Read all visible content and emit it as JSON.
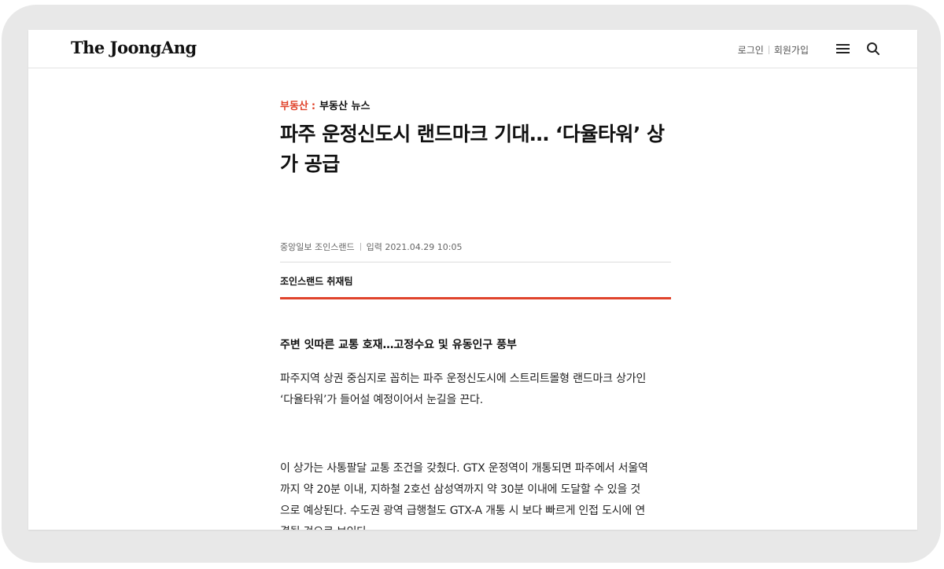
{
  "header": {
    "logo": "The JoongAng",
    "login": "로그인",
    "signup": "회원가입",
    "menu_icon": "hamburger-menu-icon",
    "search_icon": "search-icon"
  },
  "article": {
    "section": "부동산",
    "section_separator": ":",
    "subsection": "부동산 뉴스",
    "headline": "파주 운정신도시 랜드마크 기대… ‘다율타워’ 상가 공급",
    "source": "중앙일보 조인스랜드",
    "published": "입력 2021.04.29 10:05",
    "byline": "조인스랜드 취재팀",
    "subheadline": "주변 잇따른 교통 호재…고정수요 및 유동인구 풍부",
    "paragraphs": [
      "파주지역 상권 중심지로 꼽히는 파주 운정신도시에 스트리트몰형 랜드마크 상가인  ‘다율타워’가 들어설 예정이어서 눈길을 끈다.",
      "이 상가는 사통팔달 교통 조건을 갖췄다. GTX 운정역이 개통되면 파주에서 서울역까지 약 20분 이내, 지하철 2호선 삼성역까지 약 30분 이내에 도달할 수 있을  것으로 예상된다. 수도권 광역 급행철도 GTX-A 개통 시 보다 빠르게 인접 도시에 연결될 것으로 보인다."
    ]
  },
  "colors": {
    "accent": "#e0432b",
    "text": "#111111",
    "bezel": "#e8e8e8"
  }
}
